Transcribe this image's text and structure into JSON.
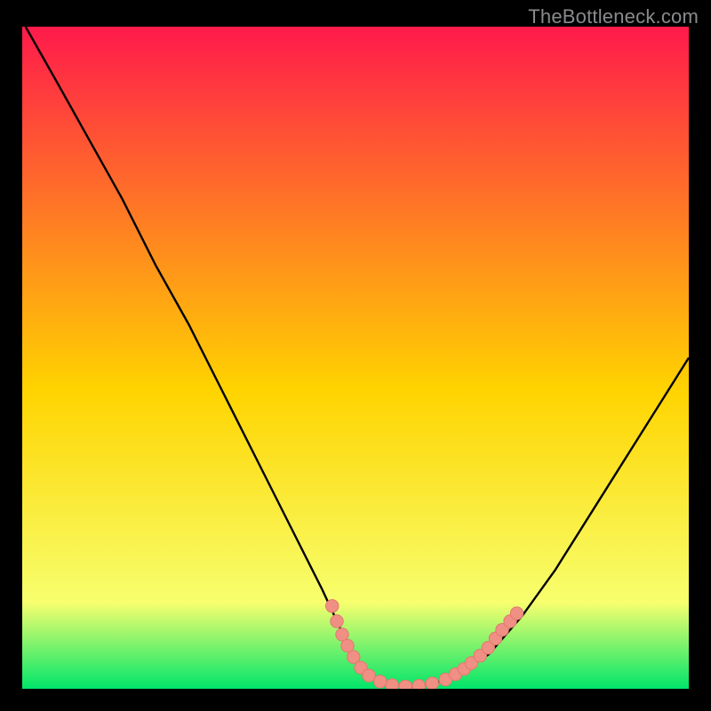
{
  "attribution": "TheBottleneck.com",
  "colors": {
    "background": "#000000",
    "gradient_top": "#ff1a4b",
    "gradient_mid": "#ffd400",
    "gradient_premin": "#f7ff6e",
    "gradient_min": "#00e56a",
    "curve": "#000000",
    "marker_fill": "#f08f84",
    "marker_stroke": "#e2796e"
  },
  "chart_data": {
    "type": "line",
    "title": "",
    "xlabel": "",
    "ylabel": "",
    "xlim": [
      0,
      100
    ],
    "ylim": [
      0,
      100
    ],
    "curve_points": [
      {
        "x": 0.5,
        "y": 100
      },
      {
        "x": 5,
        "y": 92
      },
      {
        "x": 10,
        "y": 83
      },
      {
        "x": 15,
        "y": 74
      },
      {
        "x": 20,
        "y": 64
      },
      {
        "x": 25,
        "y": 55
      },
      {
        "x": 30,
        "y": 45
      },
      {
        "x": 35,
        "y": 35
      },
      {
        "x": 40,
        "y": 25
      },
      {
        "x": 45,
        "y": 15
      },
      {
        "x": 48,
        "y": 8.5
      },
      {
        "x": 50,
        "y": 4.5
      },
      {
        "x": 52,
        "y": 2.2
      },
      {
        "x": 55,
        "y": 0.8
      },
      {
        "x": 58,
        "y": 0.3
      },
      {
        "x": 60,
        "y": 0.5
      },
      {
        "x": 63,
        "y": 1.2
      },
      {
        "x": 66,
        "y": 2.6
      },
      {
        "x": 70,
        "y": 5.2
      },
      {
        "x": 75,
        "y": 11
      },
      {
        "x": 80,
        "y": 18
      },
      {
        "x": 85,
        "y": 26
      },
      {
        "x": 90,
        "y": 34
      },
      {
        "x": 95,
        "y": 42
      },
      {
        "x": 100,
        "y": 50
      }
    ],
    "markers": [
      {
        "x": 46.5,
        "y": 12.5
      },
      {
        "x": 47.2,
        "y": 10.2
      },
      {
        "x": 48,
        "y": 8.2
      },
      {
        "x": 48.8,
        "y": 6.5
      },
      {
        "x": 49.7,
        "y": 4.8
      },
      {
        "x": 50.8,
        "y": 3.2
      },
      {
        "x": 52,
        "y": 2.0
      },
      {
        "x": 53.7,
        "y": 1.1
      },
      {
        "x": 55.5,
        "y": 0.55
      },
      {
        "x": 57.5,
        "y": 0.35
      },
      {
        "x": 59.5,
        "y": 0.45
      },
      {
        "x": 61.5,
        "y": 0.8
      },
      {
        "x": 63.5,
        "y": 1.4
      },
      {
        "x": 65,
        "y": 2.2
      },
      {
        "x": 66.3,
        "y": 3.0
      },
      {
        "x": 67.4,
        "y": 3.9
      },
      {
        "x": 68.7,
        "y": 5.0
      },
      {
        "x": 69.9,
        "y": 6.2
      },
      {
        "x": 71,
        "y": 7.6
      },
      {
        "x": 72,
        "y": 8.9
      },
      {
        "x": 73.2,
        "y": 10.2
      },
      {
        "x": 74.2,
        "y": 11.4
      }
    ]
  }
}
